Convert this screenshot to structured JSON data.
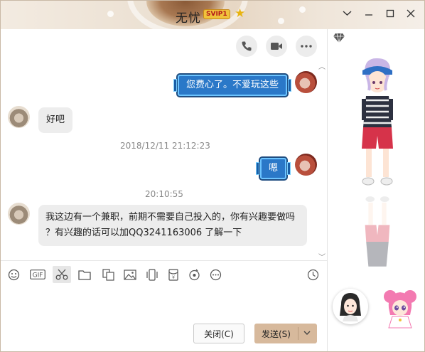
{
  "window": {
    "title": "无忧",
    "badge": "SVIP1",
    "controls": {
      "collapse": "chevron-down-icon",
      "minimize": "minimize-icon",
      "maximize": "maximize-icon",
      "close": "close-icon"
    }
  },
  "header_actions": [
    "phone-icon",
    "video-icon",
    "more-icon"
  ],
  "messages": [
    {
      "from": "me",
      "text": "您费心了。不爱玩这些"
    },
    {
      "from": "other",
      "text": "好吧"
    },
    {
      "type": "timestamp",
      "text": "2018/12/11 21:12:23"
    },
    {
      "from": "me",
      "text": "嗯"
    },
    {
      "type": "timestamp",
      "text": "20:10:55"
    },
    {
      "from": "other",
      "lines": [
        "我这边有一个兼职，前期不需要自己投入的，你有兴趣要做吗",
        "？有兴趣的话可以加QQ3241163006 了解一下"
      ]
    }
  ],
  "toolbar": [
    "emoji-icon",
    "gif-icon",
    "scissors-icon",
    "folder-icon",
    "image-edit-icon",
    "picture-icon",
    "phone-shake-icon",
    "red-packet-icon",
    "music-icon",
    "more-icon",
    "history-icon"
  ],
  "buttons": {
    "close": "关闭(C)",
    "send": "发送(S)"
  },
  "colors": {
    "my_bubble": "#2a78c8",
    "other_bubble": "#ededed",
    "send_button": "#d7b99c"
  }
}
